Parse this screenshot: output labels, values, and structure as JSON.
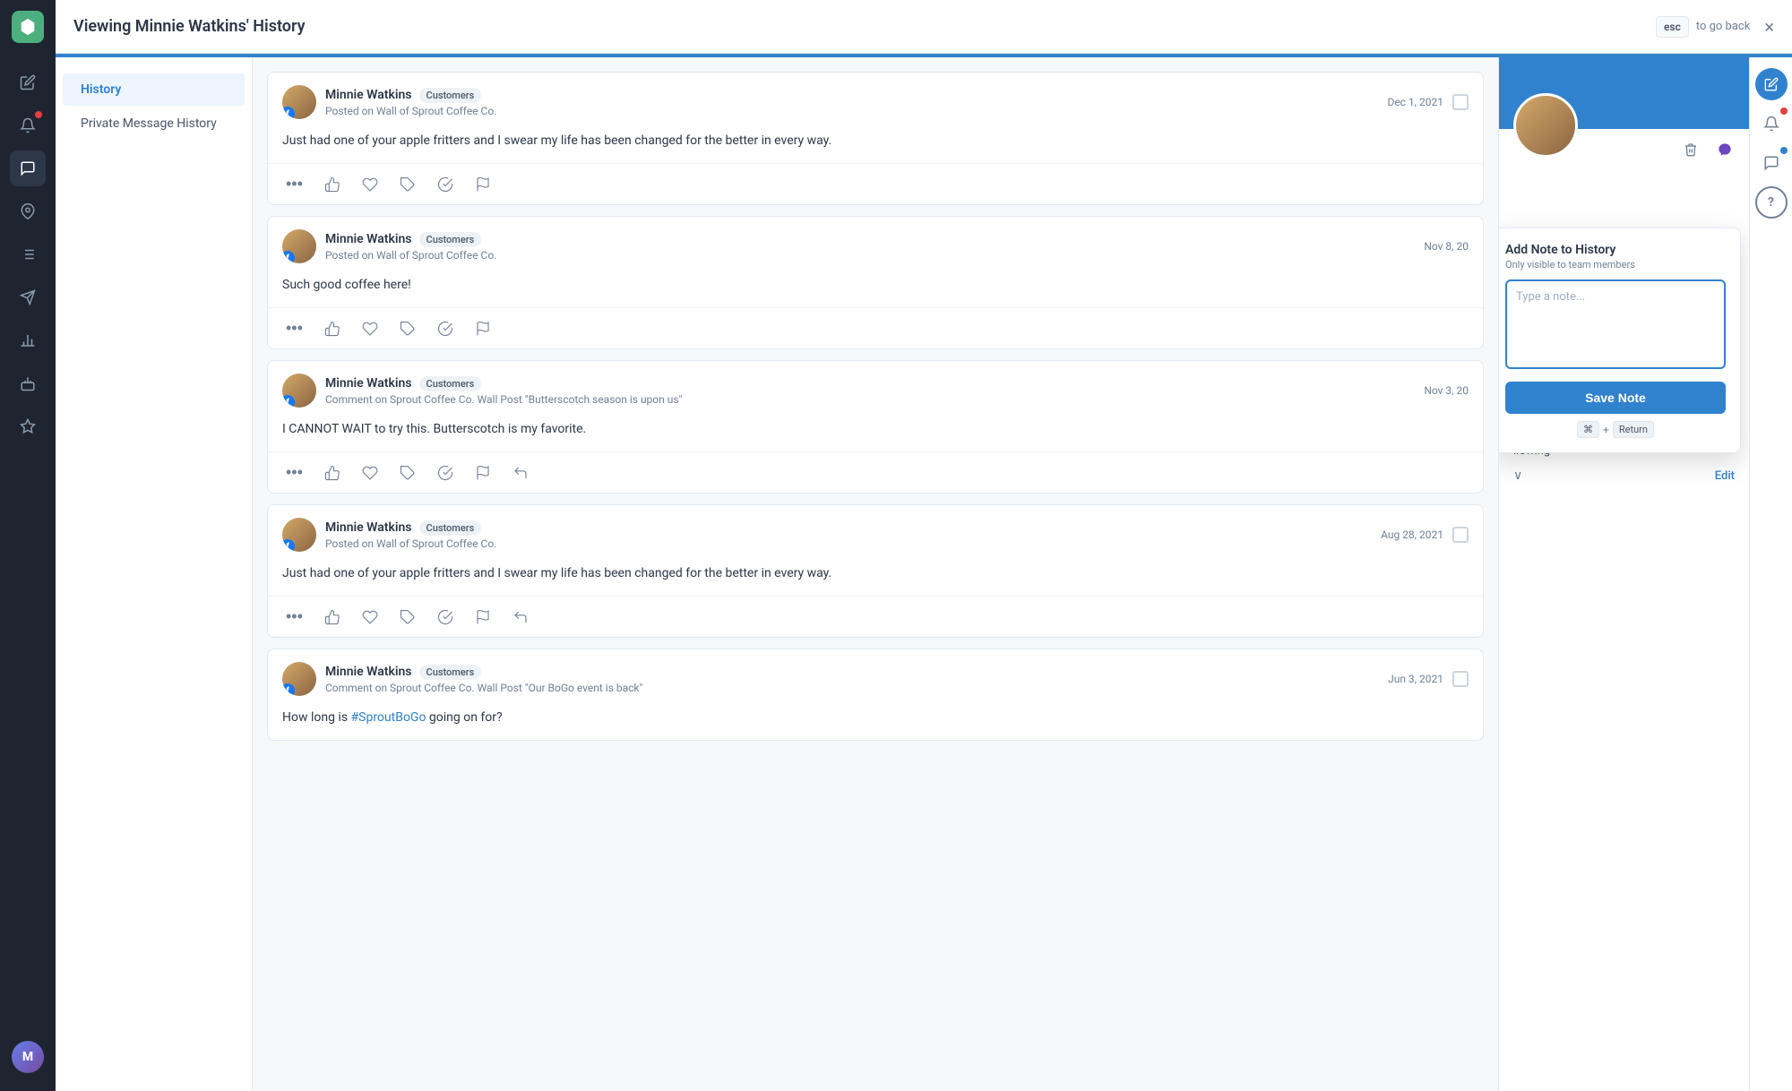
{
  "topbar": {
    "title": "Viewing Minnie Watkins' History",
    "esc_label": "esc",
    "back_label": "to go back",
    "close_icon": "×"
  },
  "left_nav": {
    "items": [
      {
        "id": "history",
        "label": "History",
        "active": true
      },
      {
        "id": "private-message-history",
        "label": "Private Message History",
        "active": false
      }
    ]
  },
  "posts": [
    {
      "id": 1,
      "author": "Minnie Watkins",
      "tag": "Customers",
      "source": "Posted on Wall of Sprout Coffee Co.",
      "date": "Dec 1, 2021",
      "content": "Just had one of your apple fritters and I swear my life has been changed for the better in every way.",
      "has_checkbox": true
    },
    {
      "id": 2,
      "author": "Minnie Watkins",
      "tag": "Customers",
      "source": "Posted on Wall of Sprout Coffee Co.",
      "date": "Nov 8, 20",
      "content": "Such good coffee here!",
      "has_checkbox": false
    },
    {
      "id": 3,
      "author": "Minnie Watkins",
      "tag": "Customers",
      "source": "Comment on Sprout Coffee Co. Wall Post \"Butterscotch season is upon us\"",
      "date": "Nov 3, 20",
      "content": "I CANNOT WAIT to try this. Butterscotch is my favorite.",
      "has_checkbox": false
    },
    {
      "id": 4,
      "author": "Minnie Watkins",
      "tag": "Customers",
      "source": "Posted on Wall of Sprout Coffee Co.",
      "date": "Aug 28, 2021",
      "content": "Just had one of your apple fritters and I swear my life has been changed for the better in every way.",
      "has_checkbox": true
    },
    {
      "id": 5,
      "author": "Minnie Watkins",
      "tag": "Customers",
      "source": "Comment on Sprout Coffee Co. Wall Post \"Our BoGo event is back\"",
      "date": "Jun 3, 2021",
      "content": "How long is #SproutBoGo going on for?",
      "has_checkbox": true,
      "has_hashtag": true
    }
  ],
  "add_note_popup": {
    "title": "Add Note to History",
    "subtitle": "Only visible to team members",
    "placeholder": "Type a note...",
    "save_button_label": "Save Note",
    "shortcut_key": "⌘",
    "shortcut_return": "Return"
  },
  "profile": {
    "following_label": "llowing",
    "edit_label": "Edit"
  },
  "icons": {
    "compose": "✏️",
    "notifications": "🔔",
    "chat": "💬",
    "help": "?",
    "pin": "📌",
    "list": "☰",
    "send": "➤",
    "chart": "📊",
    "bot": "🤖",
    "star": "⭐",
    "profile_pic": "👤",
    "facebook": "f",
    "trash": "🗑",
    "messenger": "m",
    "more": "•••",
    "thumbup": "👍",
    "heart": "♡",
    "tag": "🏷",
    "check": "✓",
    "flag": "⚑",
    "reply": "↩"
  },
  "colors": {
    "accent": "#3182ce",
    "sidebar_bg": "#1e2530",
    "active_nav": "#ebf4ff"
  }
}
